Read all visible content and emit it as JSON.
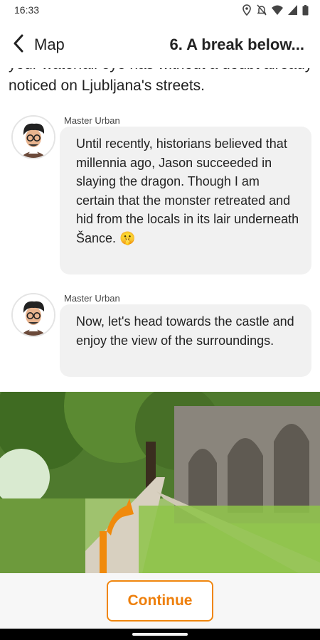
{
  "status_bar": {
    "time": "16:33",
    "icons": [
      "location-icon",
      "notifications-off-icon",
      "wifi-icon",
      "signal-icon",
      "battery-icon"
    ]
  },
  "header": {
    "back_label": "Map",
    "title": "6. A break below..."
  },
  "content": {
    "intro_text": "your waterfall eye has without a doubt already noticed on Ljubljana's streets.",
    "messages": [
      {
        "sender": "Master Urban",
        "text": "Until recently, historians believed that millennia ago, Jason succeeded in slaying the dragon. Though I am certain that the monster retreated and hid from the locals in its lair underneath Šance. 🤫"
      },
      {
        "sender": "Master Urban",
        "text": "Now, let's head towards the castle and enjoy the view of the surroundings."
      }
    ]
  },
  "footer": {
    "continue_label": "Continue"
  },
  "colors": {
    "accent": "#f0860e",
    "bubble": "#f1f1f1",
    "footer_bg": "#f7f7f7"
  }
}
